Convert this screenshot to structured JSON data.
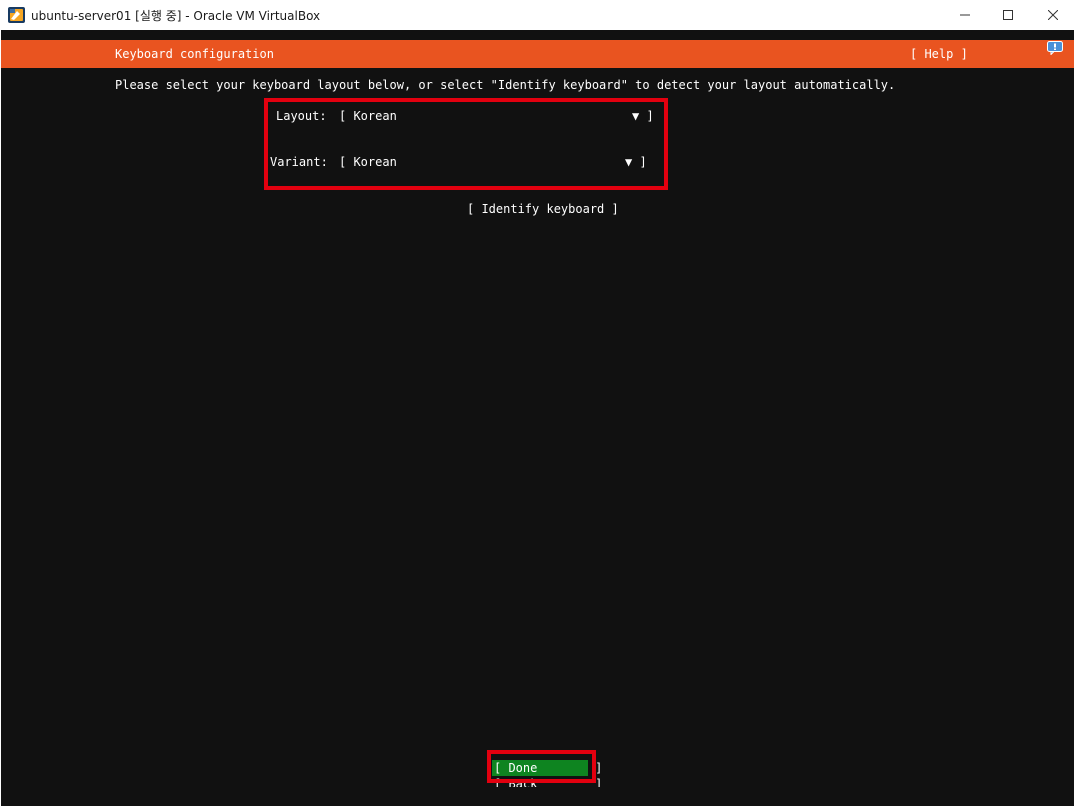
{
  "window": {
    "title": "ubuntu-server01 [실행 중] - Oracle VM VirtualBox",
    "app_icon": "virtualbox-icon",
    "controls": {
      "minimize_icon": "minimize-icon",
      "maximize_icon": "maximize-icon",
      "close_icon": "close-icon"
    }
  },
  "header": {
    "title": "Keyboard configuration",
    "help": "[ Help ]",
    "notification_icon": "notification-icon",
    "accent": "#e95420"
  },
  "instruction": "Please select your keyboard layout below, or select \"Identify keyboard\" to detect your layout automatically.",
  "form": {
    "layout": {
      "label": "Layout:",
      "value": "[ Korean",
      "arrow": "▼ ]"
    },
    "variant": {
      "label": "Variant:",
      "value": "[ Korean",
      "arrow": "▼ ]"
    }
  },
  "identify_button": "[ Identify keyboard ]",
  "footer": {
    "done": "[ Done        ]",
    "back": "[ Back        ]",
    "done_color": "#0e8420"
  },
  "highlight_color": "#e3000f"
}
